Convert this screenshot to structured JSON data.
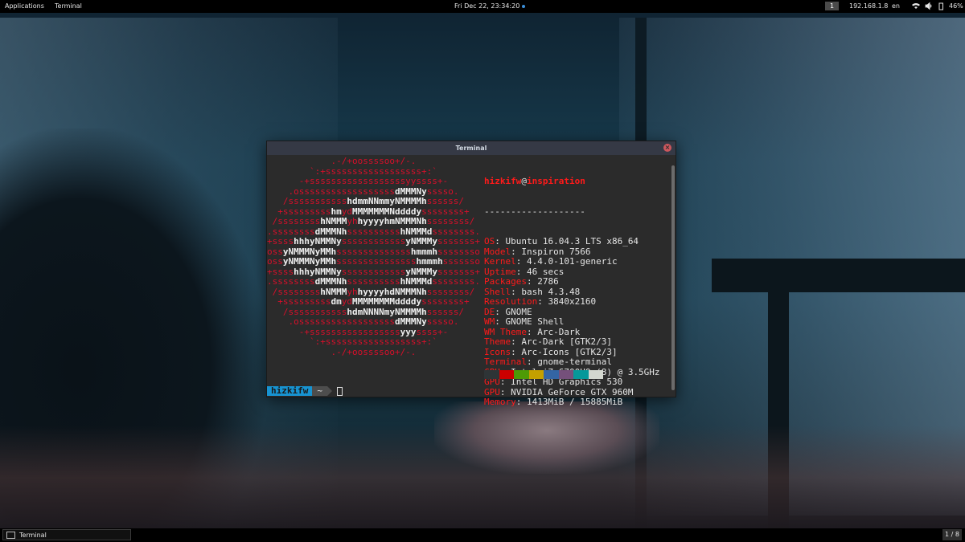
{
  "topbar": {
    "applications": "Applications",
    "app_name": "Terminal",
    "clock": "Fri Dec 22, 23:34:20",
    "workspace": "1",
    "ip": "192.168.1.8",
    "lang": "en",
    "battery": "46%"
  },
  "terminal": {
    "title": "Terminal",
    "close": "×",
    "logo_lines": [
      [
        [
          "r",
          "            .-/+oossssoo+/-."
        ]
      ],
      [
        [
          "r",
          "        `:+ssssssssssssssssss+:`"
        ]
      ],
      [
        [
          "r",
          "      -+ssssssssssssssssssyyssss+-"
        ]
      ],
      [
        [
          "r",
          "    .ossssssssssssssssss"
        ],
        [
          "w",
          "dMMMNy"
        ],
        [
          "r",
          "sssso."
        ]
      ],
      [
        [
          "r",
          "   /sssssssssss"
        ],
        [
          "w",
          "hdmmNNmmyNMMMMh"
        ],
        [
          "r",
          "ssssss/"
        ]
      ],
      [
        [
          "r",
          "  +sssssssss"
        ],
        [
          "w",
          "hm"
        ],
        [
          "r",
          "yd"
        ],
        [
          "w",
          "MMMMMMMNddddy"
        ],
        [
          "r",
          "ssssssss+"
        ]
      ],
      [
        [
          "r",
          " /ssssssss"
        ],
        [
          "w",
          "hNMMM"
        ],
        [
          "r",
          "yh"
        ],
        [
          "w",
          "hyyyyhmNMMMNh"
        ],
        [
          "r",
          "ssssssss/"
        ]
      ],
      [
        [
          "r",
          ".ssssssss"
        ],
        [
          "w",
          "dMMMNh"
        ],
        [
          "r",
          "ssssssssss"
        ],
        [
          "w",
          "hNMMMd"
        ],
        [
          "r",
          "ssssssss."
        ]
      ],
      [
        [
          "r",
          "+ssss"
        ],
        [
          "w",
          "hhhyNMMNy"
        ],
        [
          "r",
          "ssssssssssss"
        ],
        [
          "w",
          "yNMMMy"
        ],
        [
          "r",
          "sssssss+"
        ]
      ],
      [
        [
          "r",
          "oss"
        ],
        [
          "w",
          "yNMMMNyMMh"
        ],
        [
          "r",
          "ssssssssssssss"
        ],
        [
          "w",
          "hmmmh"
        ],
        [
          "r",
          "ssssssso"
        ]
      ],
      [
        [
          "r",
          "oss"
        ],
        [
          "w",
          "yNMMMNyMMh"
        ],
        [
          "r",
          "sssssssssssssss"
        ],
        [
          "w",
          "hmmmh"
        ],
        [
          "r",
          "sssssso"
        ]
      ],
      [
        [
          "r",
          "+ssss"
        ],
        [
          "w",
          "hhhyNMMNy"
        ],
        [
          "r",
          "ssssssssssss"
        ],
        [
          "w",
          "yNMMMy"
        ],
        [
          "r",
          "sssssss+"
        ]
      ],
      [
        [
          "r",
          ".ssssssss"
        ],
        [
          "w",
          "dMMMNh"
        ],
        [
          "r",
          "ssssssssss"
        ],
        [
          "w",
          "hNMMMd"
        ],
        [
          "r",
          "ssssssss."
        ]
      ],
      [
        [
          "r",
          " /ssssssss"
        ],
        [
          "w",
          "hNMMM"
        ],
        [
          "r",
          "yh"
        ],
        [
          "w",
          "hyyyyhdNMMMNh"
        ],
        [
          "r",
          "ssssssss/"
        ]
      ],
      [
        [
          "r",
          "  +sssssssss"
        ],
        [
          "w",
          "dm"
        ],
        [
          "r",
          "yd"
        ],
        [
          "w",
          "MMMMMMMMddddy"
        ],
        [
          "r",
          "ssssssss+"
        ]
      ],
      [
        [
          "r",
          "   /sssssssssss"
        ],
        [
          "w",
          "hdmNNNNmyNMMMMh"
        ],
        [
          "r",
          "ssssss/"
        ]
      ],
      [
        [
          "r",
          "    .ossssssssssssssssss"
        ],
        [
          "w",
          "dMMMNy"
        ],
        [
          "r",
          "sssso."
        ]
      ],
      [
        [
          "r",
          "      -+sssssssssssssssss"
        ],
        [
          "w",
          "yyy"
        ],
        [
          "r",
          "ssss+-"
        ]
      ],
      [
        [
          "r",
          "        `:+ssssssssssssssssss+:`"
        ]
      ],
      [
        [
          "r",
          "            .-/+oossssoo+/-."
        ]
      ]
    ],
    "user": "hizkifw",
    "at": "@",
    "host": "inspiration",
    "separator": "-------------------",
    "info": [
      {
        "k": "OS",
        "v": "Ubuntu 16.04.3 LTS x86_64"
      },
      {
        "k": "Model",
        "v": "Inspiron 7566"
      },
      {
        "k": "Kernel",
        "v": "4.4.0-101-generic"
      },
      {
        "k": "Uptime",
        "v": "46 secs"
      },
      {
        "k": "Packages",
        "v": "2786"
      },
      {
        "k": "Shell",
        "v": "bash 4.3.48"
      },
      {
        "k": "Resolution",
        "v": "3840x2160"
      },
      {
        "k": "DE",
        "v": "GNOME"
      },
      {
        "k": "WM",
        "v": "GNOME Shell"
      },
      {
        "k": "WM Theme",
        "v": "Arc-Dark"
      },
      {
        "k": "Theme",
        "v": "Arc-Dark [GTK2/3]"
      },
      {
        "k": "Icons",
        "v": "Arc-Icons [GTK2/3]"
      },
      {
        "k": "Terminal",
        "v": "gnome-terminal"
      },
      {
        "k": "CPU",
        "v": "Intel i7-6700HQ (8) @ 3.5GHz"
      },
      {
        "k": "GPU",
        "v": "Intel HD Graphics 530"
      },
      {
        "k": "GPU",
        "v": "NVIDIA GeForce GTX 960M"
      },
      {
        "k": "Memory",
        "v": "1413MiB / 15885MiB"
      }
    ],
    "palette": [
      "#2e3436",
      "#cc0000",
      "#4e9a06",
      "#c4a000",
      "#3465a4",
      "#75507b",
      "#06989a",
      "#d3d7cf"
    ],
    "prompt_user": "hizkifw",
    "prompt_dir": "~"
  },
  "bottombar": {
    "task_label": "Terminal",
    "workspace_count": "1 / 8"
  },
  "colors": {
    "logo_red": "#d70f2a",
    "key_red": "#ff1a1a",
    "prompt_blue": "#1793d1",
    "titlebar": "#353945"
  }
}
